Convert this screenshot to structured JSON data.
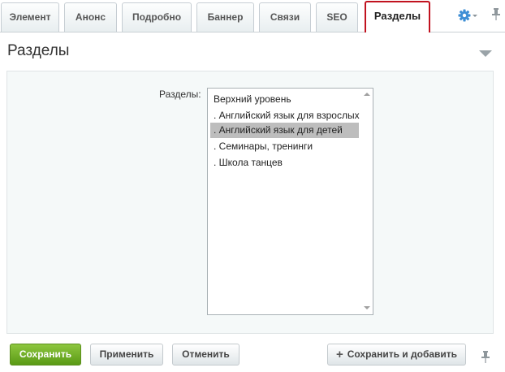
{
  "tabs": [
    {
      "label": "Элемент"
    },
    {
      "label": "Анонс"
    },
    {
      "label": "Подробно"
    },
    {
      "label": "Баннер"
    },
    {
      "label": "Связи"
    },
    {
      "label": "SEO"
    },
    {
      "label": "Разделы",
      "active": true
    }
  ],
  "header": {
    "settings_icon": "gear-icon",
    "pin_icon": "pin-icon"
  },
  "section": {
    "title": "Разделы",
    "collapse_icon": "triangle-down-icon"
  },
  "form": {
    "sections_label": "Разделы:",
    "sections_list": [
      {
        "label": "Верхний уровень",
        "selected": false
      },
      {
        "label": ". Английский язык для взрослых",
        "selected": false
      },
      {
        "label": ". Английский язык для детей",
        "selected": true
      },
      {
        "label": ". Семинары, тренинги",
        "selected": false
      },
      {
        "label": ". Школа танцев",
        "selected": false
      }
    ]
  },
  "buttons": {
    "save": "Сохранить",
    "apply": "Применить",
    "cancel": "Отменить",
    "save_and_add": "Сохранить и добавить"
  },
  "colors": {
    "active_tab_border": "#c1121f",
    "save_button": "#6aaa1f",
    "gear": "#3d8ed5",
    "selected_item": "#bdbdbd"
  }
}
